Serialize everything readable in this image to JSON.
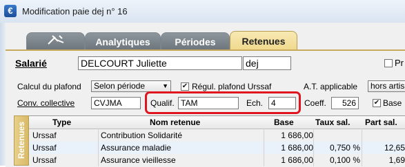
{
  "window": {
    "title": "Modification paie dej n° 16",
    "icon": "app-icon"
  },
  "tabs": [
    {
      "label": "",
      "icon": "tool-icon",
      "active": false
    },
    {
      "label": "Analytiques",
      "active": false
    },
    {
      "label": "Périodes",
      "active": false
    },
    {
      "label": "Retenues",
      "active": true
    }
  ],
  "header": {
    "salarie_label": "Salarié",
    "salarie_value": "DELCOURT Juliette",
    "code_value": "dej",
    "pr_label": "Pr"
  },
  "form": {
    "calcul_label": "Calcul du plafond",
    "calcul_value": "Selon période",
    "regul_label": "Régul. plafond Urssaf",
    "regul_checked": true,
    "at_label": "A.T. applicable",
    "at_value": "hors artis",
    "conv_label": "Conv. collective",
    "conv_value": "CVJMA",
    "qualif_label": "Qualif.",
    "qualif_value": "TAM",
    "ech_label": "Ech.",
    "ech_value": "4",
    "coeff_label": "Coeff.",
    "coeff_value": "526",
    "base_label": "Base",
    "base_checked": true
  },
  "side_tab": "Retenues",
  "table": {
    "columns": [
      "Type",
      "Nom retenue",
      "Base",
      "Taux sal.",
      "Part sal."
    ],
    "rows": [
      {
        "type": "Urssaf",
        "nom": "Contribution Solidarité",
        "base": "1 686,00",
        "taux": "",
        "part": ""
      },
      {
        "type": "Urssaf",
        "nom": "Assurance maladie",
        "base": "1 686,00",
        "taux": "0,750 %",
        "part": "12,65"
      },
      {
        "type": "Urssaf",
        "nom": "Assurance vieillesse",
        "base": "1 686,00",
        "taux": "0,100 %",
        "part": "1,69"
      }
    ]
  },
  "colors": {
    "highlight_box": "#e0141e",
    "active_tab": "#f0d98c"
  }
}
